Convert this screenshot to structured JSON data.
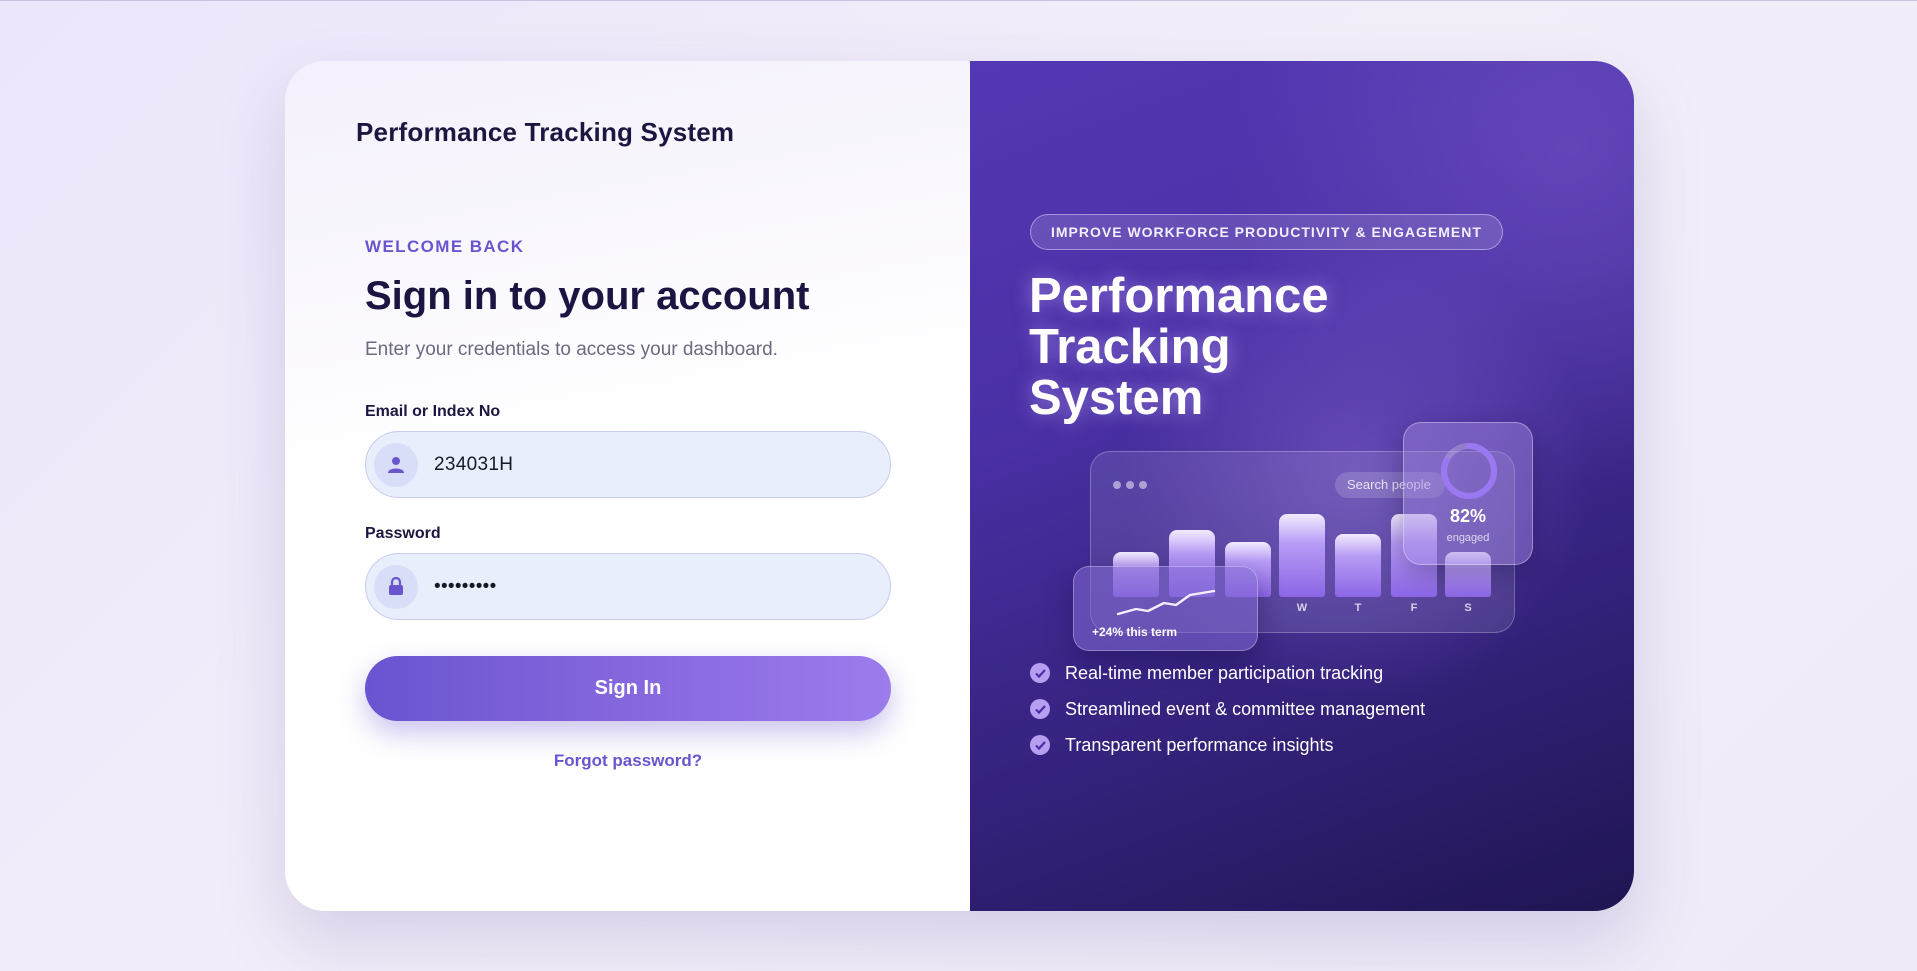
{
  "brand": {
    "name": "Performance Tracking System"
  },
  "form": {
    "eyebrow": "WELCOME BACK",
    "heading": "Sign in to your account",
    "subheading": "Enter your credentials to access your dashboard.",
    "email_label": "Email or Index No",
    "email_value": "234031H",
    "password_label": "Password",
    "password_value": "•••••••••",
    "submit_label": "Sign In",
    "forgot_label": "Forgot password?"
  },
  "promo": {
    "badge": "IMPROVE WORKFORCE PRODUCTIVITY & ENGAGEMENT",
    "title_lines": [
      "Performance",
      "Tracking",
      "System"
    ],
    "dashboard": {
      "search_placeholder": "Search people",
      "bar_labels": [
        "W",
        "T",
        "F",
        "S"
      ],
      "trend_label": "+24% this term",
      "gauge_value": "82%",
      "gauge_fraction": 0.82,
      "gauge_caption": "engaged"
    },
    "features": [
      "Real-time member participation tracking",
      "Streamlined event & committee management",
      "Transparent performance insights"
    ]
  },
  "colors": {
    "accent": "#6b55cf",
    "panel_dark": "#34217a",
    "field_bg": "#e8eefc"
  },
  "icons": {
    "email": "user-icon",
    "password": "lock-icon",
    "feature": "check-circle-icon"
  }
}
